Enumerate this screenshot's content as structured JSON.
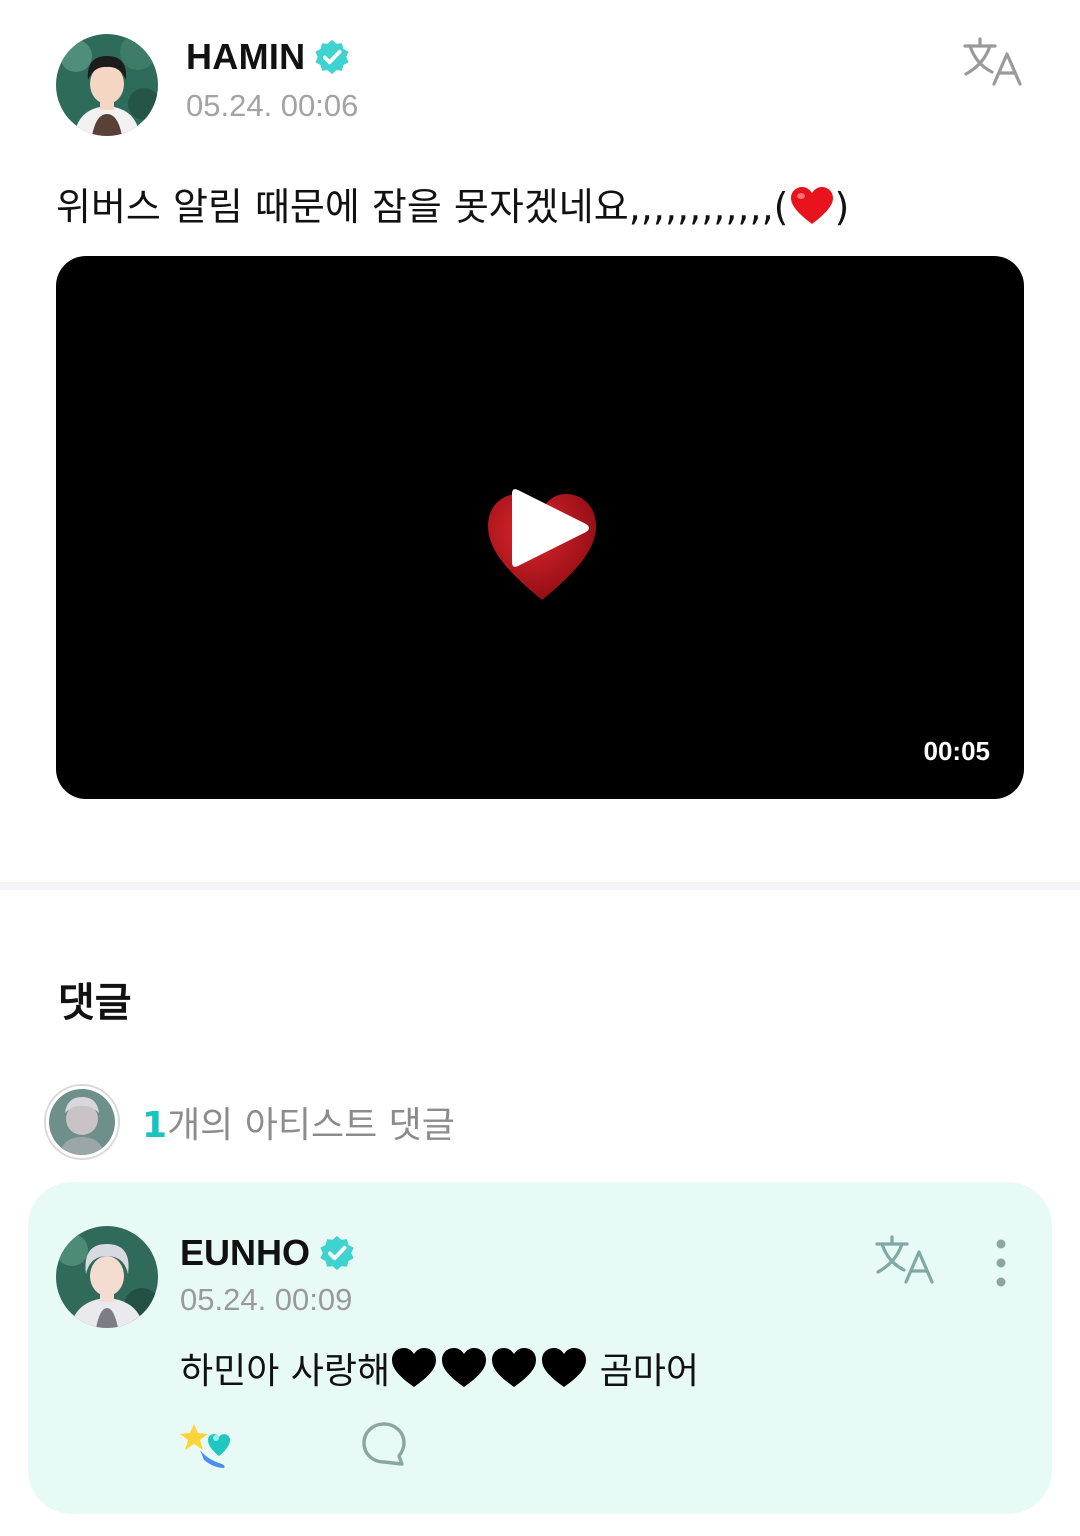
{
  "post": {
    "author_name": "HAMIN",
    "time": "05.24. 00:06",
    "body_text": "위버스 알림 때문에 잠을 못자겠네요,,,,,,,,,,,,(",
    "body_emoji": "red-heart-emoji",
    "body_close": ")",
    "video": {
      "duration": "00:05",
      "thumbnail_emoji": "red-heart-emoji"
    },
    "translate_icon": "translate-icon"
  },
  "comments": {
    "title": "댓글",
    "artist_summary": {
      "count": "1",
      "label": "개의 아티스트 댓글"
    },
    "items": [
      {
        "author_name": "EUNHO",
        "time": "05.24. 00:09",
        "text_before": "하민아 사랑해",
        "hearts_count": 4,
        "text_after": " 곰마어",
        "translate_icon": "translate-icon",
        "more_icon": "more-vertical-icon",
        "like_icon": "like-icon",
        "reply_icon": "reply-icon"
      }
    ]
  },
  "colors": {
    "accent": "#17c4be",
    "verified_badge": "#3fd3d0",
    "card_bg": "#e8faf6",
    "muted_text": "#a3a3a3",
    "divider": "#f4f5f6"
  }
}
